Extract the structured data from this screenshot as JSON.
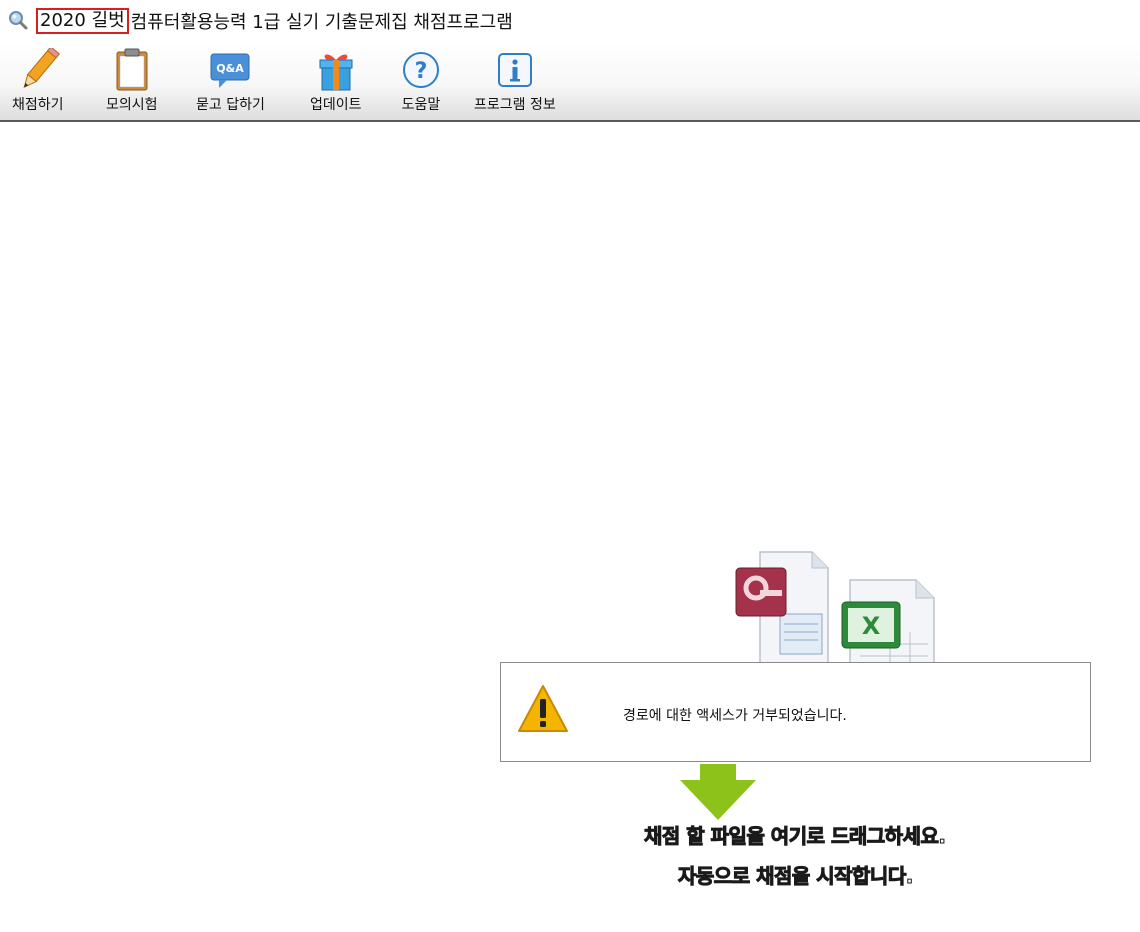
{
  "window": {
    "title_highlight": "2020 길벗",
    "title_rest": "컴퓨터활용능력 1급 실기 기출문제집 채점프로그램"
  },
  "toolbar": {
    "items": [
      {
        "label": "채점하기",
        "icon": "pencil-icon"
      },
      {
        "label": "모의시험",
        "icon": "clipboard-icon"
      },
      {
        "label": "묻고 답하기",
        "icon": "qa-bubble-icon"
      },
      {
        "label": "업데이트",
        "icon": "gift-icon"
      },
      {
        "label": "도움말",
        "icon": "help-icon"
      },
      {
        "label": "프로그램 정보",
        "icon": "info-icon"
      }
    ],
    "qa_badge": "Q&A"
  },
  "dialog": {
    "message": "경로에 대한 액세스가 거부되었습니다.",
    "icon": "warning-icon"
  },
  "dropzone": {
    "line1": [
      {
        "text": "채점 할 파일",
        "style": "blue"
      },
      {
        "text": "을 여기로 ",
        "style": "white"
      },
      {
        "text": "드래그",
        "style": "green"
      },
      {
        "text": "하세요.",
        "style": "white"
      }
    ],
    "line2": [
      {
        "text": "자동으로 채점을 시작",
        "style": "red"
      },
      {
        "text": "합니다.",
        "style": "white"
      }
    ]
  },
  "colors": {
    "highlight_border": "#d32020",
    "blue_text": "#2fa6f0",
    "green_text": "#8fd13f",
    "red_text": "#ff1a1a",
    "arrow": "#8cc21a",
    "warning": "#f4b400"
  }
}
